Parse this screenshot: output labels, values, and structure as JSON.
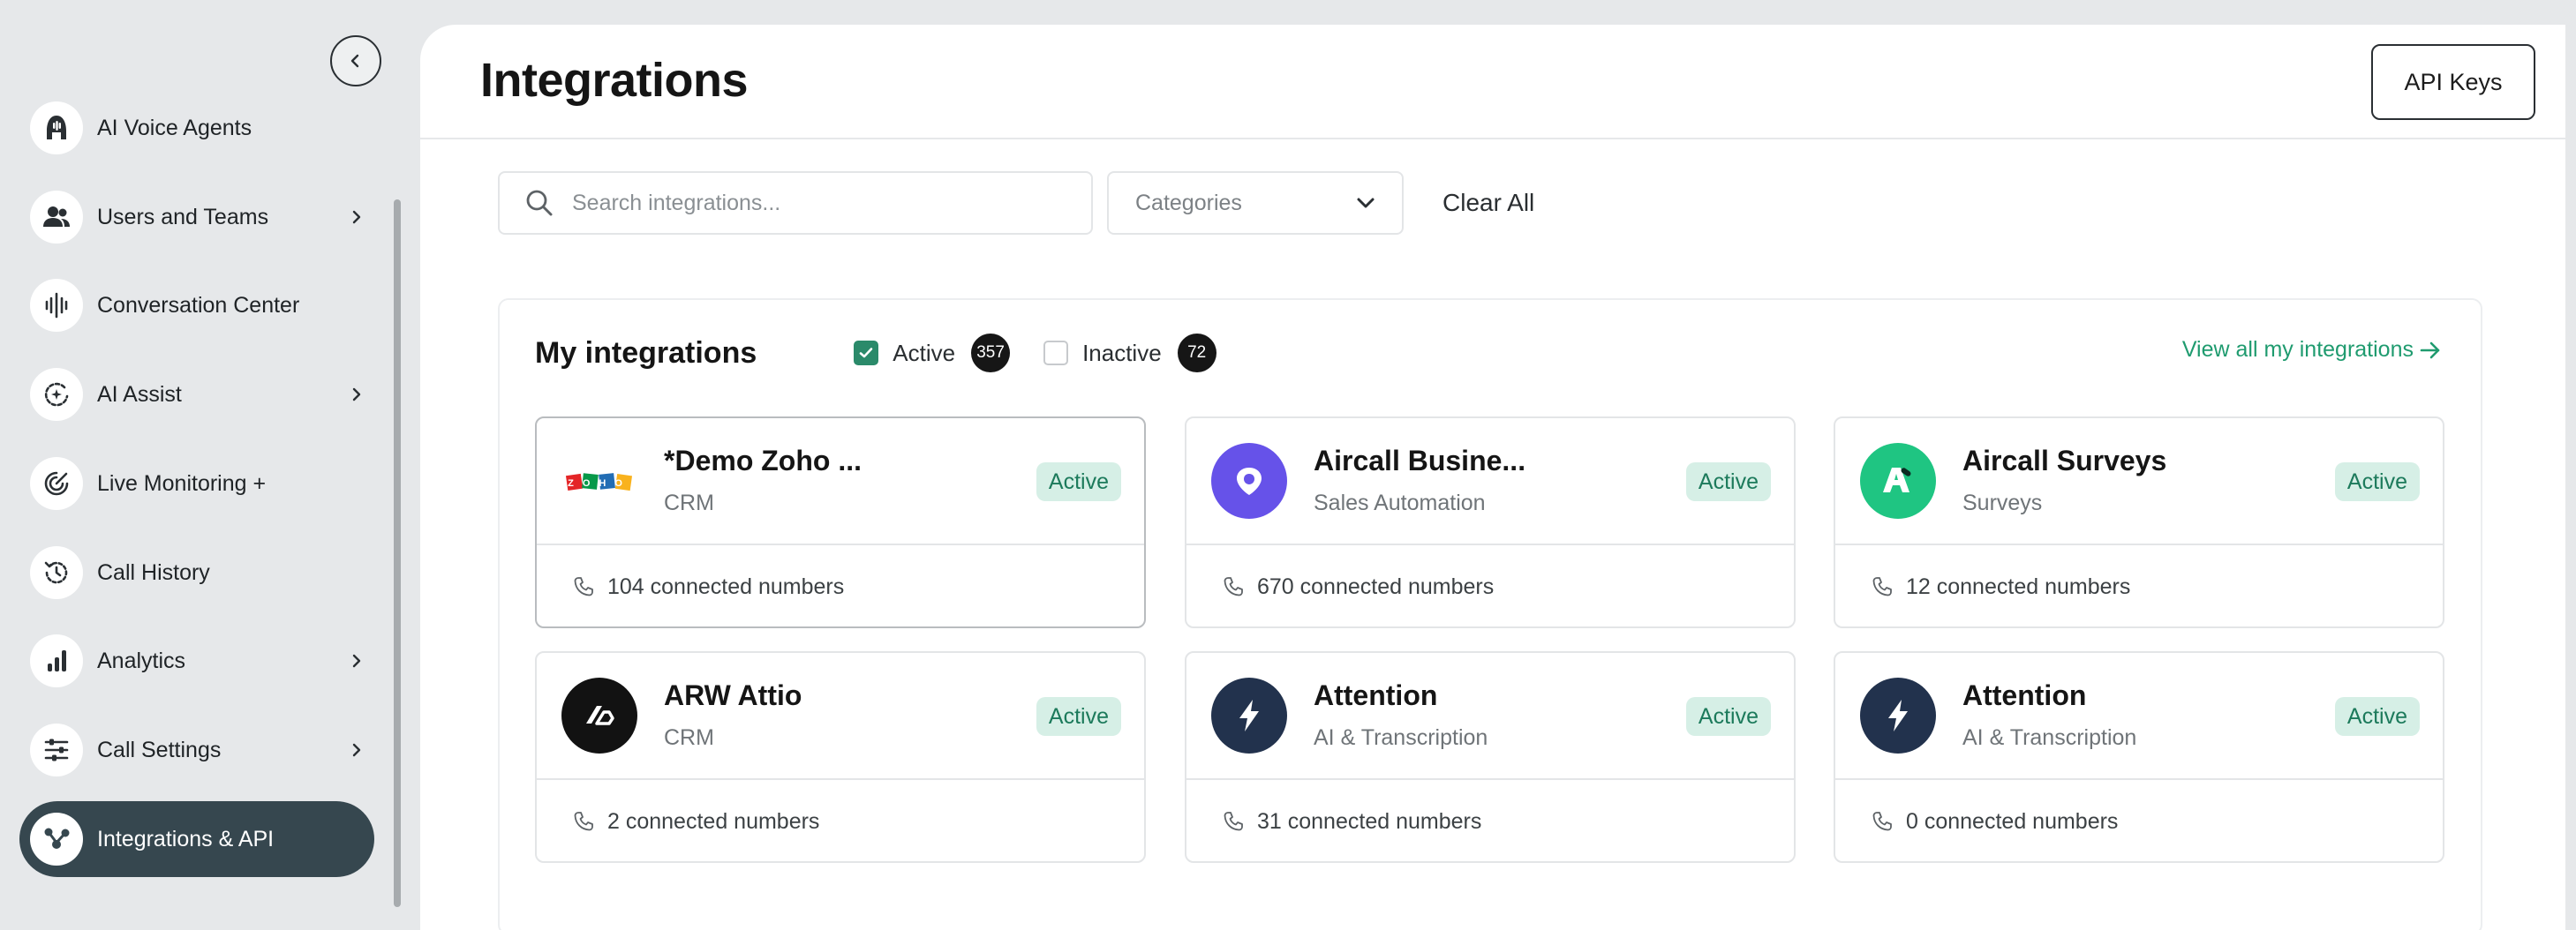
{
  "colors": {
    "accent_green": "#1f9b6f",
    "active_nav_bg": "#36474f",
    "badge_bg": "#d6efe6",
    "sidebar_bg": "#e6e8ea"
  },
  "sidebar": {
    "items": [
      {
        "label": "AI Voice Agents",
        "icon": "voice-agent-icon",
        "has_chevron": false,
        "active": false
      },
      {
        "label": "Users and Teams",
        "icon": "users-icon",
        "has_chevron": true,
        "active": false
      },
      {
        "label": "Conversation Center",
        "icon": "waveform-icon",
        "has_chevron": false,
        "active": false
      },
      {
        "label": "AI Assist",
        "icon": "ai-assist-icon",
        "has_chevron": true,
        "active": false
      },
      {
        "label": "Live Monitoring +",
        "icon": "live-monitoring-icon",
        "has_chevron": false,
        "active": false
      },
      {
        "label": "Call History",
        "icon": "history-icon",
        "has_chevron": false,
        "active": false
      },
      {
        "label": "Analytics",
        "icon": "bar-chart-icon",
        "has_chevron": true,
        "active": false
      },
      {
        "label": "Call Settings",
        "icon": "sliders-icon",
        "has_chevron": true,
        "active": false
      },
      {
        "label": "Integrations & API",
        "icon": "integrations-icon",
        "has_chevron": false,
        "active": true
      }
    ]
  },
  "header": {
    "title": "Integrations",
    "api_keys_label": "API Keys"
  },
  "filters": {
    "search_placeholder": "Search integrations...",
    "categories_label": "Categories",
    "clear_all_label": "Clear All"
  },
  "my_integrations": {
    "title": "My integrations",
    "active_label": "Active",
    "active_count": "357",
    "active_checked": true,
    "inactive_label": "Inactive",
    "inactive_count": "72",
    "inactive_checked": false,
    "view_all_label": "View all my integrations"
  },
  "cards": [
    {
      "name": "*Demo Zoho ...",
      "category": "CRM",
      "status": "Active",
      "connected": "104 connected numbers",
      "logo": "zoho-logo"
    },
    {
      "name": "Aircall Busine...",
      "category": "Sales Automation",
      "status": "Active",
      "connected": "670 connected numbers",
      "logo": "aircall-business-logo"
    },
    {
      "name": "Aircall Surveys",
      "category": "Surveys",
      "status": "Active",
      "connected": "12 connected numbers",
      "logo": "aircall-surveys-logo"
    },
    {
      "name": "ARW Attio",
      "category": "CRM",
      "status": "Active",
      "connected": "2 connected numbers",
      "logo": "attio-logo"
    },
    {
      "name": "Attention",
      "category": "AI & Transcription",
      "status": "Active",
      "connected": "31 connected numbers",
      "logo": "attention-logo"
    },
    {
      "name": "Attention",
      "category": "AI & Transcription",
      "status": "Active",
      "connected": "0 connected numbers",
      "logo": "attention-logo"
    }
  ],
  "zoho_logo_text": "ZOHO"
}
